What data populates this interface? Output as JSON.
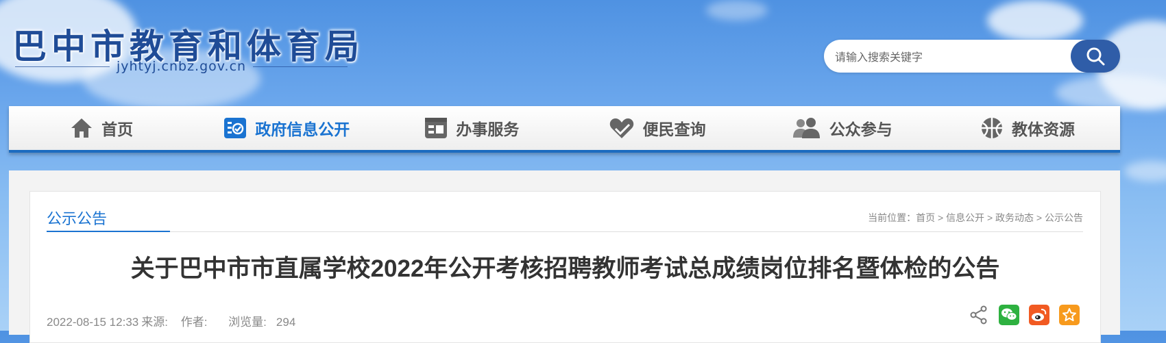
{
  "site": {
    "title": "巴中市教育和体育局",
    "domain": "jyhtyj.cnbz.gov.cn"
  },
  "search": {
    "placeholder": "请输入搜索关键字",
    "button_icon": "search-icon"
  },
  "nav": {
    "items": [
      {
        "label": "首页",
        "icon": "home-icon"
      },
      {
        "label": "政府信息公开",
        "icon": "info-check-icon",
        "active": true
      },
      {
        "label": "办事服务",
        "icon": "service-icon"
      },
      {
        "label": "便民查询",
        "icon": "heart-hand-icon"
      },
      {
        "label": "公众参与",
        "icon": "people-icon"
      },
      {
        "label": "教体资源",
        "icon": "ball-icon"
      }
    ],
    "active_color": "#1a73d1"
  },
  "section": {
    "title": "公示公告",
    "breadcrumb": {
      "prefix": "当前位置：",
      "items": [
        "首页",
        "信息公开",
        "政务动态",
        "公示公告"
      ],
      "separator": " > "
    }
  },
  "article": {
    "title": "关于巴中市市直属学校2022年公开考核招聘教师考试总成绩岗位排名暨体检的公告",
    "date": "2022-08-15 12:33",
    "source_label": "来源:",
    "author_label": "作者:",
    "views_label": "浏览量:",
    "views": "294"
  },
  "share": {
    "icons": [
      "share-icon",
      "wechat-icon",
      "weibo-icon",
      "favorite-icon"
    ],
    "colors": {
      "wechat": "#2eb140",
      "weibo": "#f15a22",
      "favorite": "#f79a1d"
    }
  }
}
